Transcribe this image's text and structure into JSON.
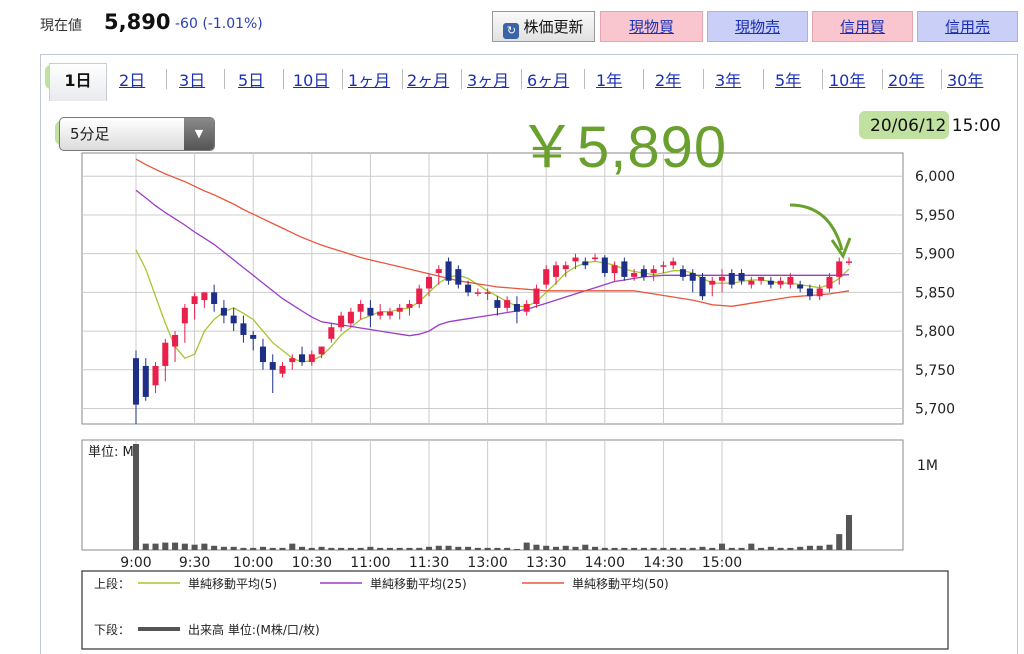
{
  "header": {
    "label": "現在値",
    "price": "5,890",
    "change": "-60 (-1.01%)",
    "update_btn": "株価更新",
    "buttons": [
      "現物買",
      "現物売",
      "信用買",
      "信用売"
    ]
  },
  "tabs": [
    "1日",
    "2日",
    "3日",
    "5日",
    "10日",
    "1ヶ月",
    "2ヶ月",
    "3ヶ月",
    "6ヶ月",
    "1年",
    "2年",
    "3年",
    "5年",
    "10年",
    "20年",
    "30年"
  ],
  "interval_select": "5分足",
  "datetime": {
    "date": "20/06/12",
    "time": "15:00"
  },
  "annotation": "￥5,890",
  "chart_data": {
    "type": "candlestick",
    "y_ticks": [
      "6,000",
      "5,950",
      "5,900",
      "5,850",
      "5,800",
      "5,750",
      "5,700"
    ],
    "y_range": [
      5680,
      6030
    ],
    "x_labels": [
      "9:00",
      "9:30",
      "10:00",
      "10:30",
      "11:00",
      "11:30",
      "13:00",
      "13:30",
      "14:00",
      "14:30",
      "15:00"
    ],
    "volume_unit": "単位: M",
    "volume_tick": "1M",
    "candles": [
      [
        5765,
        5680,
        5775,
        5705
      ],
      [
        5755,
        5710,
        5765,
        5715
      ],
      [
        5730,
        5720,
        5760,
        5755
      ],
      [
        5755,
        5735,
        5790,
        5785
      ],
      [
        5780,
        5760,
        5800,
        5795
      ],
      [
        5810,
        5785,
        5835,
        5830
      ],
      [
        5835,
        5815,
        5850,
        5845
      ],
      [
        5840,
        5830,
        5850,
        5850
      ],
      [
        5850,
        5825,
        5860,
        5835
      ],
      [
        5830,
        5810,
        5840,
        5820
      ],
      [
        5820,
        5800,
        5830,
        5810
      ],
      [
        5810,
        5785,
        5820,
        5795
      ],
      [
        5795,
        5775,
        5800,
        5790
      ],
      [
        5780,
        5750,
        5790,
        5760
      ],
      [
        5760,
        5720,
        5770,
        5750
      ],
      [
        5745,
        5740,
        5760,
        5755
      ],
      [
        5760,
        5750,
        5770,
        5765
      ],
      [
        5770,
        5755,
        5780,
        5760
      ],
      [
        5760,
        5755,
        5775,
        5770
      ],
      [
        5770,
        5765,
        5780,
        5780
      ],
      [
        5790,
        5785,
        5810,
        5805
      ],
      [
        5805,
        5800,
        5825,
        5820
      ],
      [
        5810,
        5805,
        5830,
        5825
      ],
      [
        5825,
        5815,
        5840,
        5835
      ],
      [
        5830,
        5805,
        5840,
        5820
      ],
      [
        5820,
        5815,
        5835,
        5825
      ],
      [
        5820,
        5815,
        5830,
        5825
      ],
      [
        5825,
        5815,
        5835,
        5830
      ],
      [
        5830,
        5820,
        5840,
        5835
      ],
      [
        5835,
        5830,
        5860,
        5855
      ],
      [
        5855,
        5845,
        5875,
        5870
      ],
      [
        5875,
        5860,
        5885,
        5880
      ],
      [
        5890,
        5860,
        5895,
        5865
      ],
      [
        5880,
        5855,
        5885,
        5860
      ],
      [
        5860,
        5845,
        5865,
        5850
      ],
      [
        5850,
        5845,
        5855,
        5850
      ],
      [
        5850,
        5840,
        5855,
        5850
      ],
      [
        5840,
        5820,
        5845,
        5830
      ],
      [
        5830,
        5825,
        5845,
        5840
      ],
      [
        5835,
        5810,
        5845,
        5825
      ],
      [
        5825,
        5820,
        5840,
        5835
      ],
      [
        5835,
        5830,
        5860,
        5855
      ],
      [
        5860,
        5855,
        5885,
        5880
      ],
      [
        5870,
        5860,
        5890,
        5885
      ],
      [
        5880,
        5870,
        5890,
        5885
      ],
      [
        5890,
        5880,
        5900,
        5895
      ],
      [
        5890,
        5880,
        5895,
        5885
      ],
      [
        5895,
        5890,
        5900,
        5895
      ],
      [
        5895,
        5870,
        5898,
        5875
      ],
      [
        5875,
        5865,
        5890,
        5885
      ],
      [
        5890,
        5865,
        5895,
        5870
      ],
      [
        5870,
        5865,
        5880,
        5875
      ],
      [
        5880,
        5865,
        5885,
        5870
      ],
      [
        5875,
        5865,
        5885,
        5880
      ],
      [
        5885,
        5875,
        5890,
        5885
      ],
      [
        5885,
        5880,
        5895,
        5890
      ],
      [
        5880,
        5865,
        5885,
        5870
      ],
      [
        5875,
        5850,
        5880,
        5865
      ],
      [
        5870,
        5840,
        5875,
        5845
      ],
      [
        5860,
        5845,
        5870,
        5865
      ],
      [
        5865,
        5850,
        5880,
        5870
      ],
      [
        5875,
        5855,
        5880,
        5860
      ],
      [
        5875,
        5860,
        5880,
        5865
      ],
      [
        5860,
        5855,
        5870,
        5865
      ],
      [
        5865,
        5860,
        5870,
        5870
      ],
      [
        5865,
        5855,
        5870,
        5860
      ],
      [
        5860,
        5855,
        5870,
        5865
      ],
      [
        5860,
        5855,
        5875,
        5870
      ],
      [
        5860,
        5850,
        5865,
        5855
      ],
      [
        5855,
        5840,
        5860,
        5845
      ],
      [
        5845,
        5840,
        5860,
        5855
      ],
      [
        5855,
        5850,
        5875,
        5870
      ],
      [
        5870,
        5860,
        5895,
        5890
      ],
      [
        5890,
        5885,
        5895,
        5890
      ]
    ],
    "volumes": [
      1.0,
      0.06,
      0.06,
      0.07,
      0.07,
      0.06,
      0.05,
      0.06,
      0.04,
      0.03,
      0.03,
      0.02,
      0.02,
      0.03,
      0.02,
      0.02,
      0.06,
      0.03,
      0.02,
      0.03,
      0.02,
      0.02,
      0.02,
      0.02,
      0.03,
      0.02,
      0.02,
      0.02,
      0.02,
      0.02,
      0.03,
      0.04,
      0.04,
      0.03,
      0.03,
      0.02,
      0.02,
      0.02,
      0.02,
      0.01,
      0.07,
      0.05,
      0.04,
      0.03,
      0.04,
      0.03,
      0.05,
      0.03,
      0.02,
      0.02,
      0.02,
      0.02,
      0.02,
      0.02,
      0.02,
      0.02,
      0.02,
      0.02,
      0.03,
      0.02,
      0.06,
      0.02,
      0.02,
      0.06,
      0.02,
      0.03,
      0.02,
      0.02,
      0.03,
      0.04,
      0.04,
      0.05,
      0.15,
      0.33
    ],
    "series": [
      {
        "name": "単純移動平均(5)",
        "color": "#a6c630",
        "values": [
          5905,
          5880,
          5845,
          5810,
          5780,
          5765,
          5770,
          5800,
          5815,
          5825,
          5830,
          5823,
          5815,
          5800,
          5785,
          5775,
          5765,
          5760,
          5762,
          5768,
          5780,
          5795,
          5805,
          5815,
          5820,
          5825,
          5825,
          5828,
          5830,
          5838,
          5850,
          5862,
          5870,
          5872,
          5868,
          5860,
          5852,
          5845,
          5838,
          5832,
          5832,
          5838,
          5850,
          5862,
          5875,
          5883,
          5888,
          5890,
          5888,
          5885,
          5880,
          5877,
          5875,
          5873,
          5875,
          5878,
          5878,
          5875,
          5868,
          5862,
          5862,
          5862,
          5864,
          5866,
          5866,
          5864,
          5862,
          5862,
          5860,
          5858,
          5856,
          5860,
          5868,
          5880
        ]
      },
      {
        "name": "単純移動平均(25)",
        "color": "#9b3dc8",
        "values": [
          5982,
          5972,
          5962,
          5953,
          5945,
          5937,
          5928,
          5920,
          5912,
          5902,
          5892,
          5882,
          5872,
          5862,
          5852,
          5842,
          5834,
          5826,
          5818,
          5812,
          5810,
          5808,
          5806,
          5804,
          5802,
          5800,
          5798,
          5796,
          5794,
          5796,
          5800,
          5808,
          5812,
          5814,
          5816,
          5818,
          5820,
          5822,
          5824,
          5826,
          5828,
          5832,
          5836,
          5840,
          5844,
          5848,
          5852,
          5856,
          5860,
          5864,
          5866,
          5868,
          5870,
          5871,
          5872,
          5872,
          5872,
          5872,
          5872,
          5872,
          5872,
          5872,
          5872,
          5872,
          5872,
          5872,
          5872,
          5872,
          5872,
          5872,
          5872,
          5872,
          5872,
          5873
        ]
      },
      {
        "name": "単純移動平均(50)",
        "color": "#e8573c",
        "values": [
          6022,
          6015,
          6009,
          6003,
          5998,
          5993,
          5987,
          5981,
          5976,
          5970,
          5964,
          5957,
          5951,
          5945,
          5939,
          5933,
          5927,
          5921,
          5916,
          5911,
          5907,
          5903,
          5899,
          5895,
          5892,
          5889,
          5886,
          5883,
          5880,
          5877,
          5874,
          5871,
          5868,
          5865,
          5863,
          5861,
          5859,
          5857,
          5856,
          5855,
          5854,
          5853,
          5852,
          5852,
          5852,
          5852,
          5852,
          5852,
          5852,
          5852,
          5852,
          5852,
          5850,
          5848,
          5846,
          5844,
          5842,
          5840,
          5837,
          5834,
          5833,
          5832,
          5834,
          5836,
          5838,
          5840,
          5842,
          5844,
          5845,
          5846,
          5847,
          5848,
          5850,
          5852
        ]
      }
    ],
    "legend": {
      "upper_label": "上段：",
      "lower_label": "下段：",
      "volume_label": "出来高 単位:(M株/口/枚)"
    }
  }
}
